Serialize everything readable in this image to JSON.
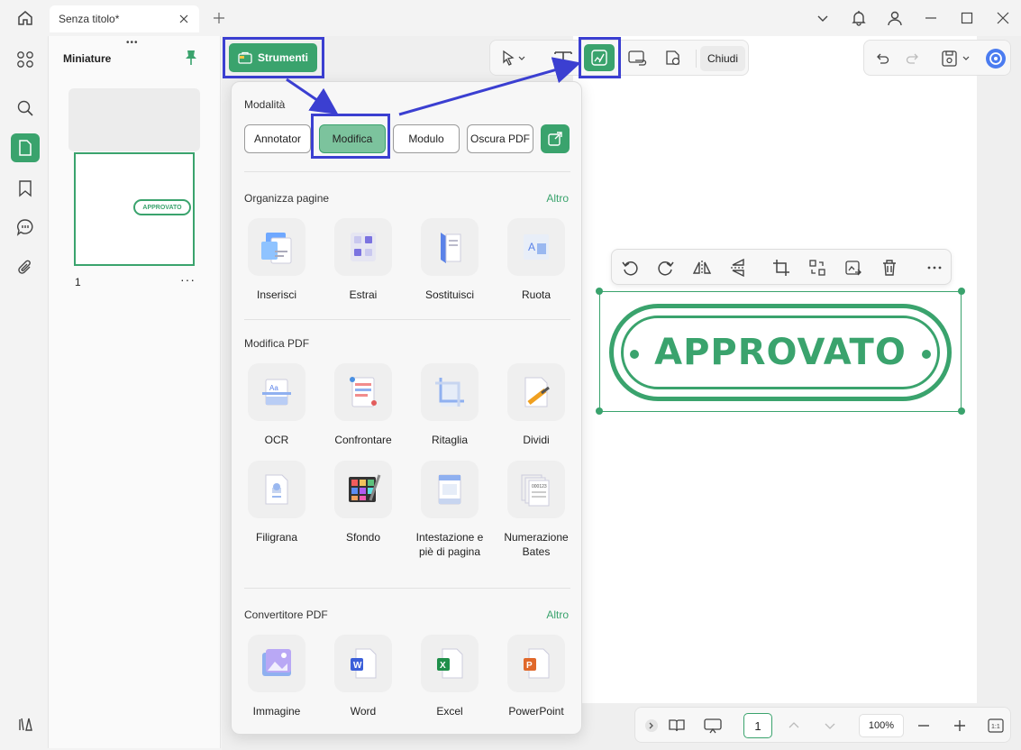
{
  "window": {
    "tab_title": "Senza titolo*"
  },
  "thumbnails": {
    "title": "Miniature",
    "page_number": "1",
    "stamp_text": "APPROVATO"
  },
  "toolbar": {
    "strumenti_label": "Strumenti",
    "close_label": "Chiudi"
  },
  "dropdown": {
    "modes_title": "Modalità",
    "modes": [
      "Annotator",
      "Modifica",
      "Modulo",
      "Oscura PDF"
    ],
    "active_mode": "Modifica",
    "organize": {
      "title": "Organizza pagine",
      "more": "Altro",
      "tools": [
        "Inserisci",
        "Estrai",
        "Sostituisci",
        "Ruota"
      ]
    },
    "edit_pdf": {
      "title": "Modifica PDF",
      "tools": [
        "OCR",
        "Confrontare",
        "Ritaglia",
        "Dividi",
        "Filigrana",
        "Sfondo",
        "Intestazione e piè di pagina",
        "Numerazione Bates"
      ]
    },
    "converter": {
      "title": "Convertitore PDF",
      "more": "Altro",
      "tools": [
        "Immagine",
        "Word",
        "Excel",
        "PowerPoint"
      ]
    }
  },
  "document": {
    "stamp_text": "APPROVATO"
  },
  "bottom": {
    "page": "1",
    "zoom": "100%"
  },
  "colors": {
    "accent": "#3aa36d",
    "highlight": "#3b3fd1"
  }
}
